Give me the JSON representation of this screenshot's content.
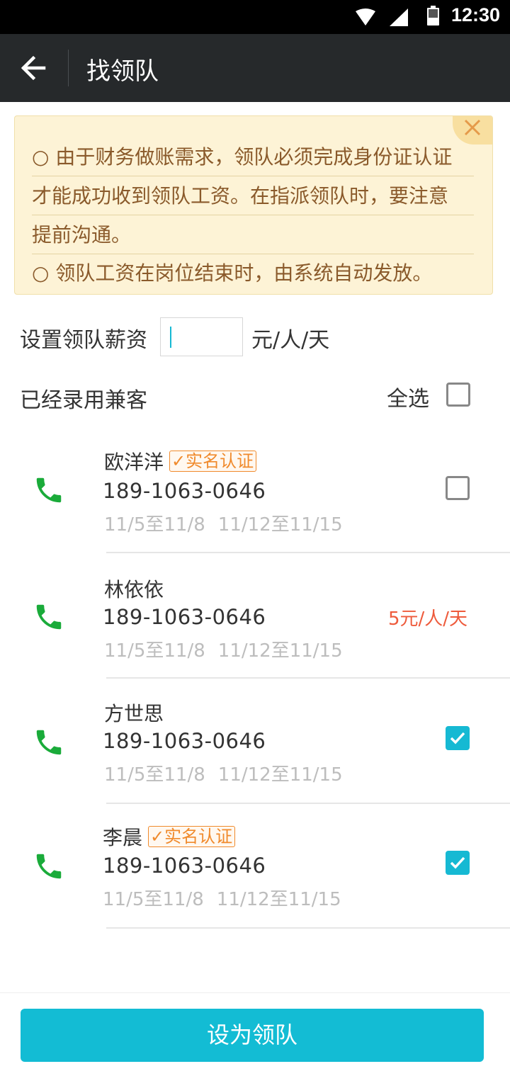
{
  "status_bar": {
    "time": "12:30"
  },
  "app_bar": {
    "title": "找领队"
  },
  "notice": {
    "lines": [
      "○ 由于财务做账需求，领队必须完成身份证认证",
      "才能成功收到领队工资。在指派领队时，要注意",
      "提前沟通。",
      "○ 领队工资在岗位结束时，由系统自动发放。"
    ]
  },
  "salary": {
    "label": "设置领队薪资",
    "value": "",
    "unit": "元/人/天"
  },
  "hired_section": {
    "title": "已经录用兼客",
    "select_all_label": "全选",
    "select_all_checked": false
  },
  "people": [
    {
      "name": "欧洋洋",
      "badge": "✓实名认证",
      "phone": "189-1063-0646",
      "dates": [
        "11/5至11/8",
        "11/12至11/15"
      ],
      "checked": false,
      "rate": ""
    },
    {
      "name": "林依依",
      "badge": "",
      "phone": "189-1063-0646",
      "dates": [
        "11/5至11/8",
        "11/12至11/15"
      ],
      "checked": null,
      "rate": "5元/人/天"
    },
    {
      "name": "方世思",
      "badge": "",
      "phone": "189-1063-0646",
      "dates": [
        "11/5至11/8",
        "11/12至11/15"
      ],
      "checked": true,
      "rate": ""
    },
    {
      "name": "李晨",
      "badge": "✓实名认证",
      "phone": "189-1063-0646",
      "dates": [
        "11/5至11/8",
        "11/12至11/15"
      ],
      "checked": true,
      "rate": ""
    }
  ],
  "footer": {
    "button_label": "设为领队"
  },
  "icons": {
    "back": "arrow-left-icon",
    "phone": "phone-icon",
    "close": "close-icon",
    "check": "checkmark-icon"
  },
  "colors": {
    "accent": "#13bcd4",
    "phone_green": "#1aab3a",
    "rate_red": "#ee5b3c",
    "badge_orange": "#f08a2c",
    "notice_bg": "#fdf3d6",
    "notice_text": "#8a5a2b",
    "app_bar": "#26292b"
  }
}
